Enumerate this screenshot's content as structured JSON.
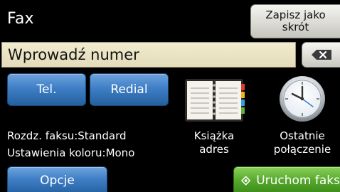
{
  "header": {
    "title": "Fax",
    "shortcut_label": "Zapisz jako skrót"
  },
  "number_entry": {
    "placeholder": "Wprowadź numer",
    "backspace_icon": "backspace-icon"
  },
  "buttons": {
    "tel_label": "Tel.",
    "redial_label": "Redial",
    "options_label": "Opcje",
    "start_label": "Uruchom faks"
  },
  "status": {
    "resolution": "Rozdz. faksu:Standard",
    "color": "Ustawienia koloru:Mono"
  },
  "tiles": {
    "address_book": {
      "line1": "Książka",
      "line2": "adres",
      "icon": "address-book-icon"
    },
    "recent_calls": {
      "line1": "Ostatnie",
      "line2": "połączenie",
      "icon": "clock-icon"
    }
  },
  "colors": {
    "blue_button": "#3f7fc6",
    "start_button": "#55a82c",
    "entry_field": "#ece5c6"
  }
}
